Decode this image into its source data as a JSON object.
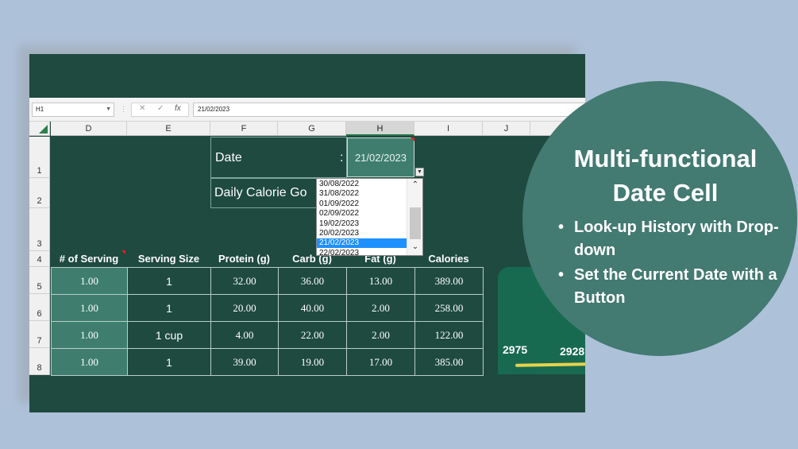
{
  "formula_bar": {
    "name_box": "H1",
    "cancel_symbol": "✕",
    "enter_symbol": "✓",
    "fx_symbol": "fx",
    "value": "21/02/2023"
  },
  "columns": [
    "D",
    "E",
    "F",
    "G",
    "H",
    "I",
    "J"
  ],
  "rows": [
    "1",
    "2",
    "3",
    "4",
    "5",
    "6",
    "7",
    "8"
  ],
  "date_section": {
    "date_label": "Date",
    "colon": ":",
    "date_value": "21/02/2023",
    "calorie_goal_label": "Daily Calorie Go"
  },
  "dropdown": {
    "options": [
      "30/08/2022",
      "31/08/2022",
      "01/09/2022",
      "02/09/2022",
      "19/02/2023",
      "20/02/2023",
      "21/02/2023",
      "22/02/2023"
    ],
    "selected_index": 6
  },
  "table": {
    "headers": [
      "# of Serving",
      "Serving Size",
      "Protein (g)",
      "Carb (g)",
      "Fat (g)",
      "Calories"
    ],
    "rows": [
      [
        "1.00",
        "1",
        "32.00",
        "36.00",
        "13.00",
        "389.00"
      ],
      [
        "1.00",
        "1",
        "20.00",
        "40.00",
        "2.00",
        "258.00"
      ],
      [
        "1.00",
        "1 cup",
        "4.00",
        "22.00",
        "2.00",
        "122.00"
      ],
      [
        "1.00",
        "1",
        "39.00",
        "19.00",
        "17.00",
        "385.00"
      ]
    ]
  },
  "mini_card": {
    "value_1": "2975",
    "value_2": "2928"
  },
  "promo": {
    "title_line1": "Multi-functional",
    "title_line2": "Date Cell",
    "bullets": [
      "Look-up History with Drop-down",
      "Set the Current Date with a Button"
    ]
  },
  "colors": {
    "background": "#adc1d9",
    "sheet_bg": "#1f4a40",
    "cell_accent": "#3f7e6e",
    "circle": "#437a72",
    "dropdown_selected": "#1e90ff"
  }
}
